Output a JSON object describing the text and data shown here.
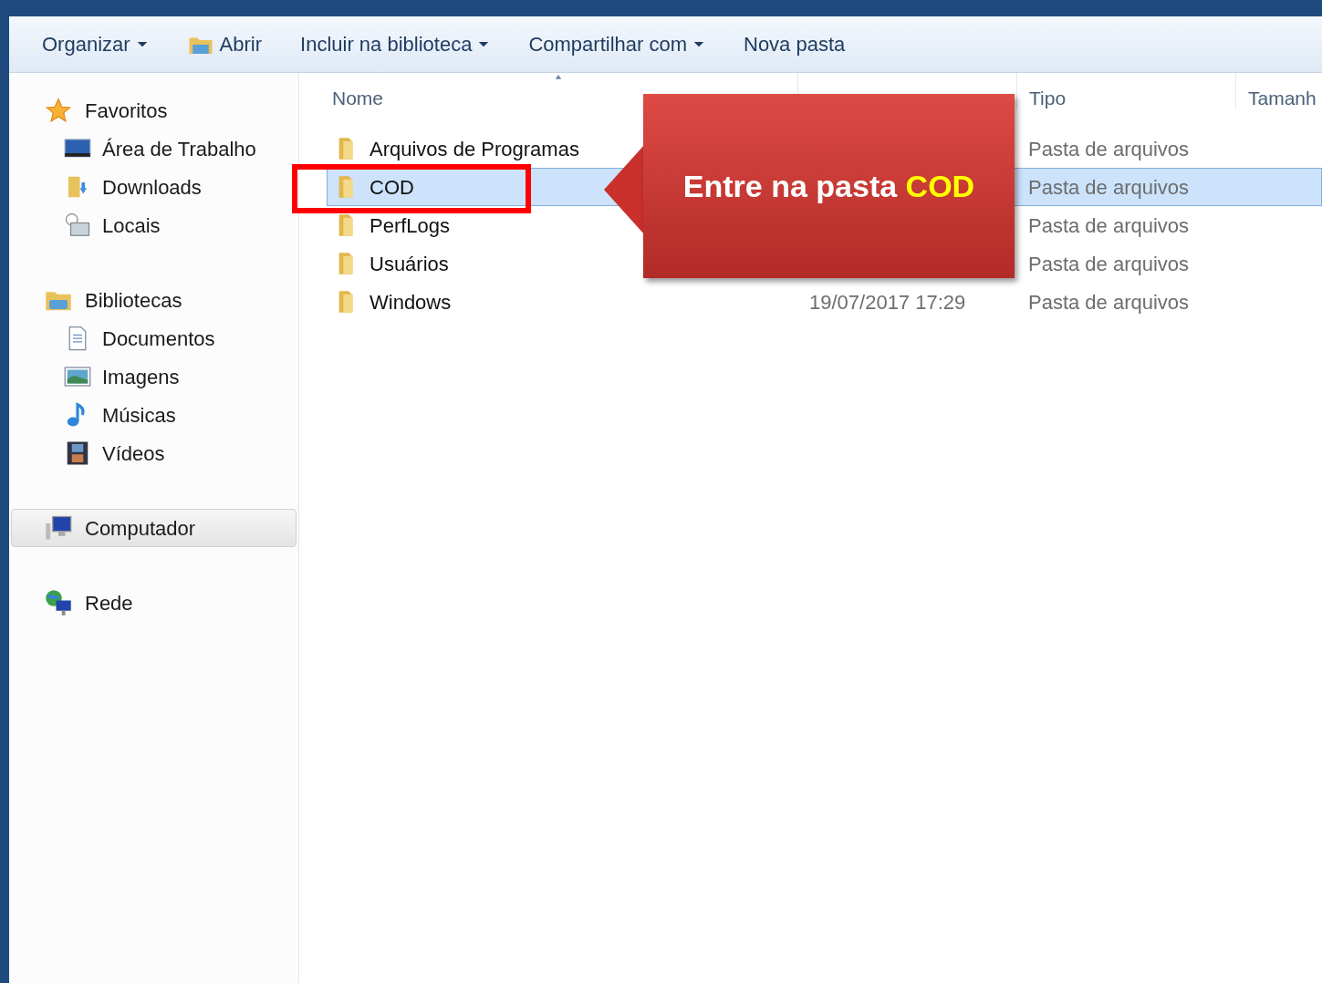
{
  "toolbar": [
    {
      "label": "Organizar",
      "dropdown": true
    },
    {
      "label": "Abrir",
      "dropdown": false
    },
    {
      "label": "Incluir na biblioteca",
      "dropdown": true
    },
    {
      "label": "Compartilhar com",
      "dropdown": true
    },
    {
      "label": "Nova pasta",
      "dropdown": false
    }
  ],
  "sidebar": [
    {
      "label": "Favoritos",
      "selected": false,
      "children": [
        {
          "label": "Área de Trabalho"
        },
        {
          "label": "Downloads"
        },
        {
          "label": "Locais"
        }
      ]
    },
    {
      "label": "Bibliotecas",
      "selected": false,
      "children": [
        {
          "label": "Documentos"
        },
        {
          "label": "Imagens"
        },
        {
          "label": "Músicas"
        },
        {
          "label": "Vídeos"
        }
      ]
    },
    {
      "label": "Computador",
      "selected": true
    },
    {
      "label": "Rede",
      "selected": false
    }
  ],
  "columns": [
    "Nome",
    "Tipo",
    "Tamanh"
  ],
  "rows": [
    {
      "name": "Arquivos de Programas",
      "type": "Pasta de arquivos",
      "selected": false
    },
    {
      "name": "COD",
      "type": "Pasta de arquivos",
      "selected": true
    },
    {
      "name": "PerfLogs",
      "type": "Pasta de arquivos",
      "selected": false
    },
    {
      "name": "Usuários",
      "type": "Pasta de arquivos",
      "selected": false
    },
    {
      "name": "Windows",
      "date": "19/07/2017 17:29",
      "type": "Pasta de arquivos",
      "selected": false
    }
  ],
  "callout": {
    "text": "Entre na pasta",
    "highlight": "COD"
  }
}
